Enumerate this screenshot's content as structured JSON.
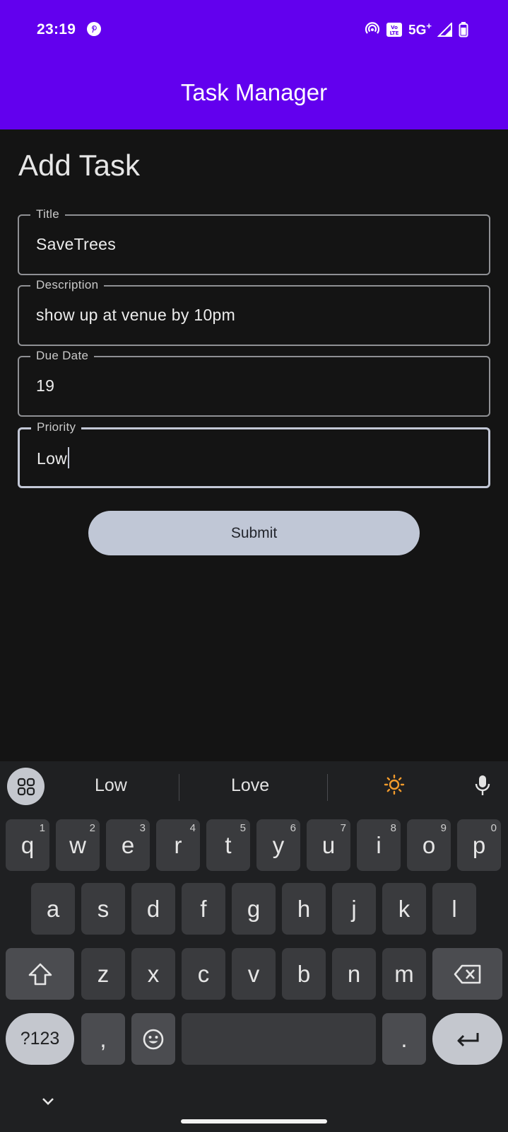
{
  "status_bar": {
    "time": "23:19",
    "network": "5G",
    "network_suffix": "+"
  },
  "app_bar": {
    "title": "Task Manager"
  },
  "page": {
    "heading": "Add Task"
  },
  "form": {
    "fields": [
      {
        "label": "Title",
        "value": "SaveTrees"
      },
      {
        "label": "Description",
        "value": "show up at venue by 10pm"
      },
      {
        "label": "Due Date",
        "value": "19"
      },
      {
        "label": "Priority",
        "value": "Low"
      }
    ],
    "submit_label": "Submit"
  },
  "keyboard": {
    "suggestions": [
      "Low",
      "Love"
    ],
    "row1": [
      {
        "k": "q",
        "h": "1"
      },
      {
        "k": "w",
        "h": "2"
      },
      {
        "k": "e",
        "h": "3"
      },
      {
        "k": "r",
        "h": "4"
      },
      {
        "k": "t",
        "h": "5"
      },
      {
        "k": "y",
        "h": "6"
      },
      {
        "k": "u",
        "h": "7"
      },
      {
        "k": "i",
        "h": "8"
      },
      {
        "k": "o",
        "h": "9"
      },
      {
        "k": "p",
        "h": "0"
      }
    ],
    "row2": [
      "a",
      "s",
      "d",
      "f",
      "g",
      "h",
      "j",
      "k",
      "l"
    ],
    "row3": [
      "z",
      "x",
      "c",
      "v",
      "b",
      "n",
      "m"
    ],
    "symbols_label": "?123",
    "comma": ",",
    "period": "."
  }
}
